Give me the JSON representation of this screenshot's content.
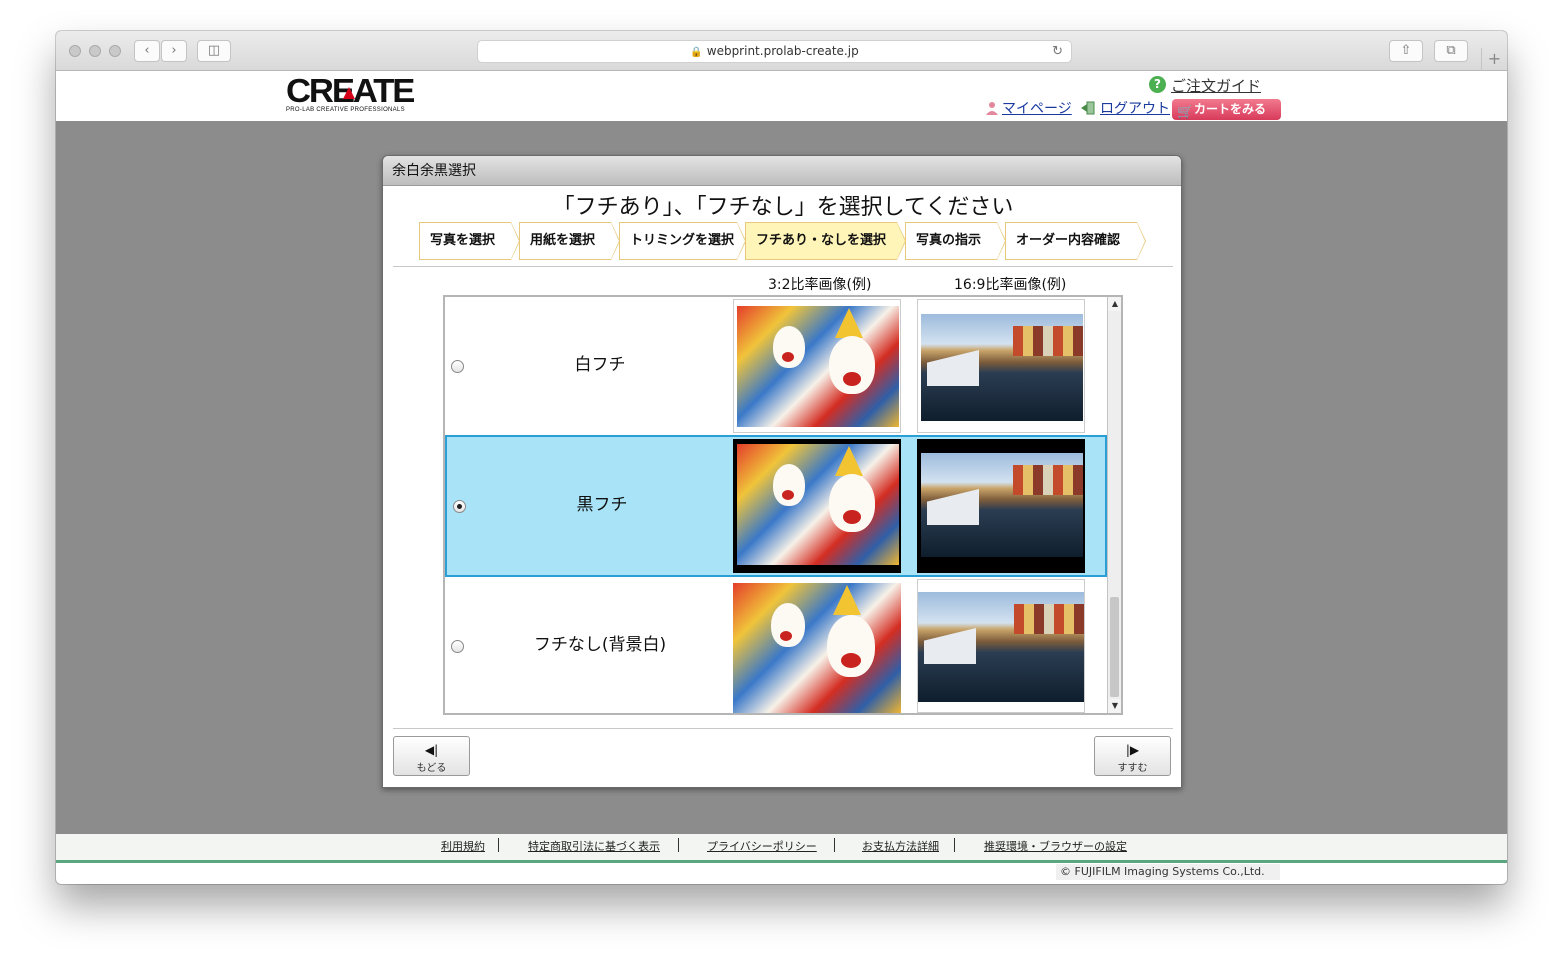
{
  "browser": {
    "url": "webprint.prolab-create.jp",
    "back_icon": "chevron-left-icon",
    "forward_icon": "chevron-right-icon",
    "new_tab": "+"
  },
  "header": {
    "logo_text": "CREATE",
    "logo_sub": "PRO-LAB CREATIVE PROFESSIONALS",
    "guide_link": "ご注文ガイド",
    "mypage_link": "マイページ",
    "logout_link": "ログアウト",
    "cart_button": "カートをみる"
  },
  "dialog": {
    "title": "余白余黒選択",
    "heading": "「フチあり」、「フチなし」を選択してください",
    "steps": [
      {
        "label": "写真を選択"
      },
      {
        "label": "用紙を選択"
      },
      {
        "label": "トリミングを選択"
      },
      {
        "label": "フチあり・なしを選択",
        "active": true
      },
      {
        "label": "写真の指示"
      },
      {
        "label": "オーダー内容確認"
      }
    ],
    "col_32": "3:2比率画像(例)",
    "col_169": "16:9比率画像(例)",
    "options": [
      {
        "label": "白フチ",
        "selected": false
      },
      {
        "label": "黒フチ",
        "selected": true
      },
      {
        "label": "フチなし(背景白)",
        "selected": false
      }
    ],
    "back_glyph": "◀|",
    "back_label": "もどる",
    "next_glyph": "|▶",
    "next_label": "すすむ"
  },
  "footer": {
    "links": [
      "利用規約",
      "特定商取引法に基づく表示",
      "プライバシーポリシー",
      "お支払方法詳細",
      "推奨環境・ブラウザーの設定"
    ],
    "copyright": "© FUJIFILM Imaging Systems Co.,Ltd."
  },
  "colors": {
    "selected_row": "#a8e3f7",
    "selected_border": "#2a9fd6",
    "active_step": "#fff5b8",
    "cart": "#e04a66"
  }
}
